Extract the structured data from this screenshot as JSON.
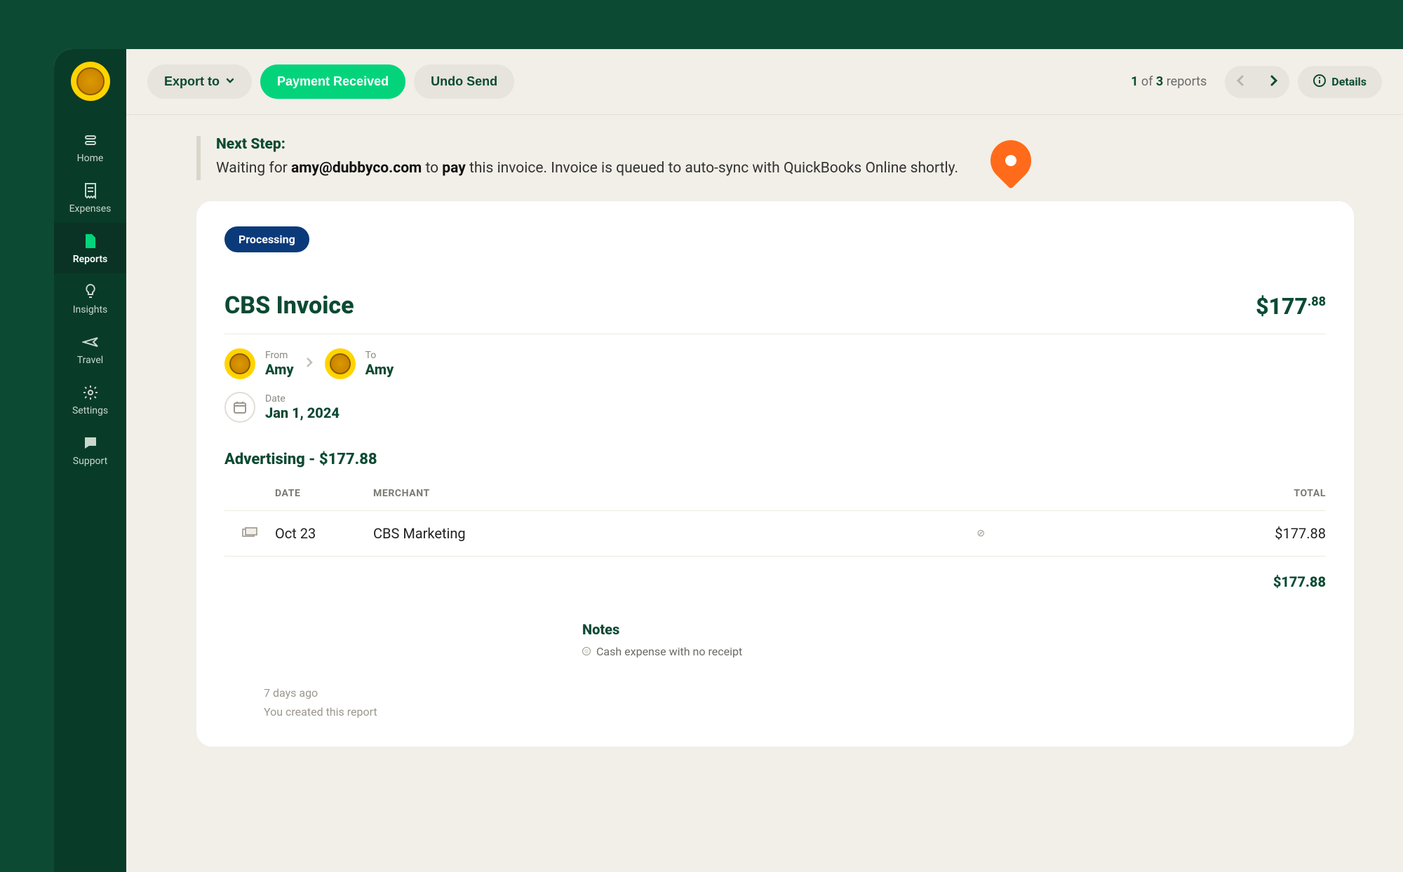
{
  "sidebar": {
    "items": [
      {
        "label": "Home"
      },
      {
        "label": "Expenses"
      },
      {
        "label": "Reports"
      },
      {
        "label": "Insights"
      },
      {
        "label": "Travel"
      },
      {
        "label": "Settings"
      },
      {
        "label": "Support"
      }
    ]
  },
  "toolbar": {
    "export_label": "Export to",
    "payment_received_label": "Payment Received",
    "undo_send_label": "Undo Send",
    "details_label": "Details",
    "pager_current": "1",
    "pager_of": "of",
    "pager_total": "3",
    "pager_suffix": "reports"
  },
  "next_step": {
    "heading": "Next Step:",
    "prefix": "Waiting for ",
    "email": "amy@dubbyco.com",
    "mid": " to ",
    "action": "pay",
    "suffix": " this invoice. Invoice is queued to auto-sync with QuickBooks Online shortly."
  },
  "invoice": {
    "status_badge": "Processing",
    "title": "CBS Invoice",
    "amount_whole": "$177",
    "amount_cents": ".88",
    "from_label": "From",
    "from_name": "Amy",
    "to_label": "To",
    "to_name": "Amy",
    "date_label": "Date",
    "date_value": "Jan 1, 2024",
    "category_line": "Advertising - $177.88",
    "columns": {
      "date": "DATE",
      "merchant": "MERCHANT",
      "total": "TOTAL"
    },
    "rows": [
      {
        "date": "Oct 23",
        "merchant": "CBS Marketing",
        "total": "$177.88"
      }
    ],
    "subtotal": "$177.88",
    "notes_heading": "Notes",
    "notes": [
      "Cash expense with no receipt"
    ],
    "history": {
      "time": "7 days ago",
      "text": "You created this report"
    }
  }
}
